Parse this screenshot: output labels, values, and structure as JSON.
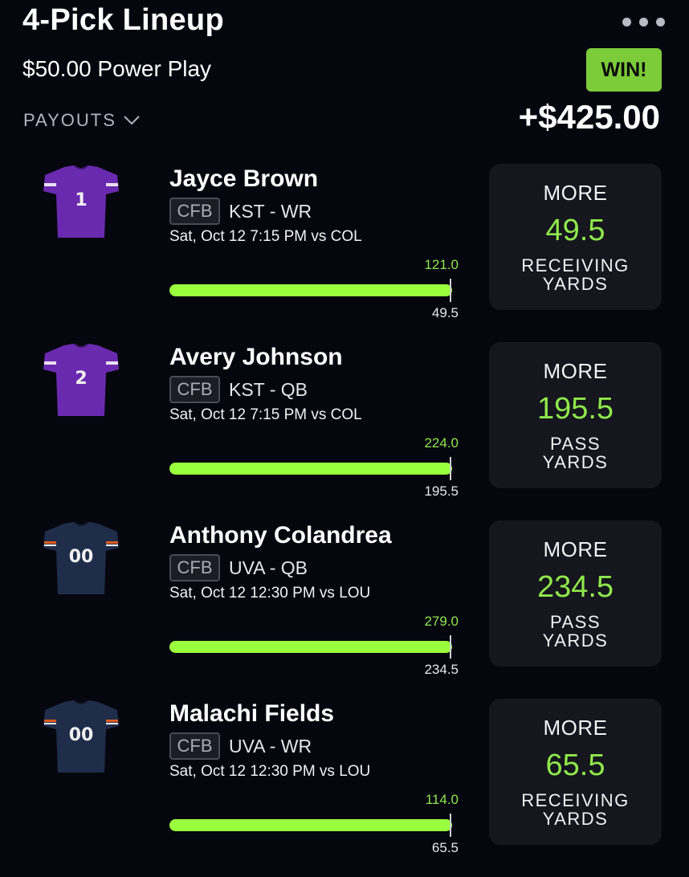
{
  "header": {
    "title": "4-Pick Lineup",
    "play_type": "$50.00 Power Play",
    "result_badge": "WIN!",
    "payouts_label": "PAYOUTS",
    "payout_amount": "+$425.00"
  },
  "colors": {
    "background": "#06060f",
    "accent_green": "#9aff3c",
    "win_badge": "#7ccc3a",
    "card": "#15161e",
    "kst_purple": "#6a2ab0",
    "uva_navy": "#1f2d4a",
    "uva_orange": "#e05a1f"
  },
  "picks": [
    {
      "player": "Jayce Brown",
      "league": "CFB",
      "team_pos": "KST - WR",
      "game": "Sat, Oct 12 7:15 PM  vs COL",
      "jersey_number": "1",
      "actual": "121.0",
      "line": "49.5",
      "progress": 1.0,
      "direction": "MORE",
      "stat": "RECEIVING YARDS"
    },
    {
      "player": "Avery Johnson",
      "league": "CFB",
      "team_pos": "KST - QB",
      "game": "Sat, Oct 12 7:15 PM  vs COL",
      "jersey_number": "2",
      "actual": "224.0",
      "line": "195.5",
      "progress": 1.0,
      "direction": "MORE",
      "stat": "PASS YARDS"
    },
    {
      "player": "Anthony Colandrea",
      "league": "CFB",
      "team_pos": "UVA - QB",
      "game": "Sat, Oct 12 12:30 PM  vs LOU",
      "jersey_number": "00",
      "actual": "279.0",
      "line": "234.5",
      "progress": 1.0,
      "direction": "MORE",
      "stat": "PASS YARDS"
    },
    {
      "player": "Malachi Fields",
      "league": "CFB",
      "team_pos": "UVA - WR",
      "game": "Sat, Oct 12 12:30 PM  vs LOU",
      "jersey_number": "00",
      "actual": "114.0",
      "line": "65.5",
      "progress": 1.0,
      "direction": "MORE",
      "stat": "RECEIVING YARDS"
    }
  ]
}
